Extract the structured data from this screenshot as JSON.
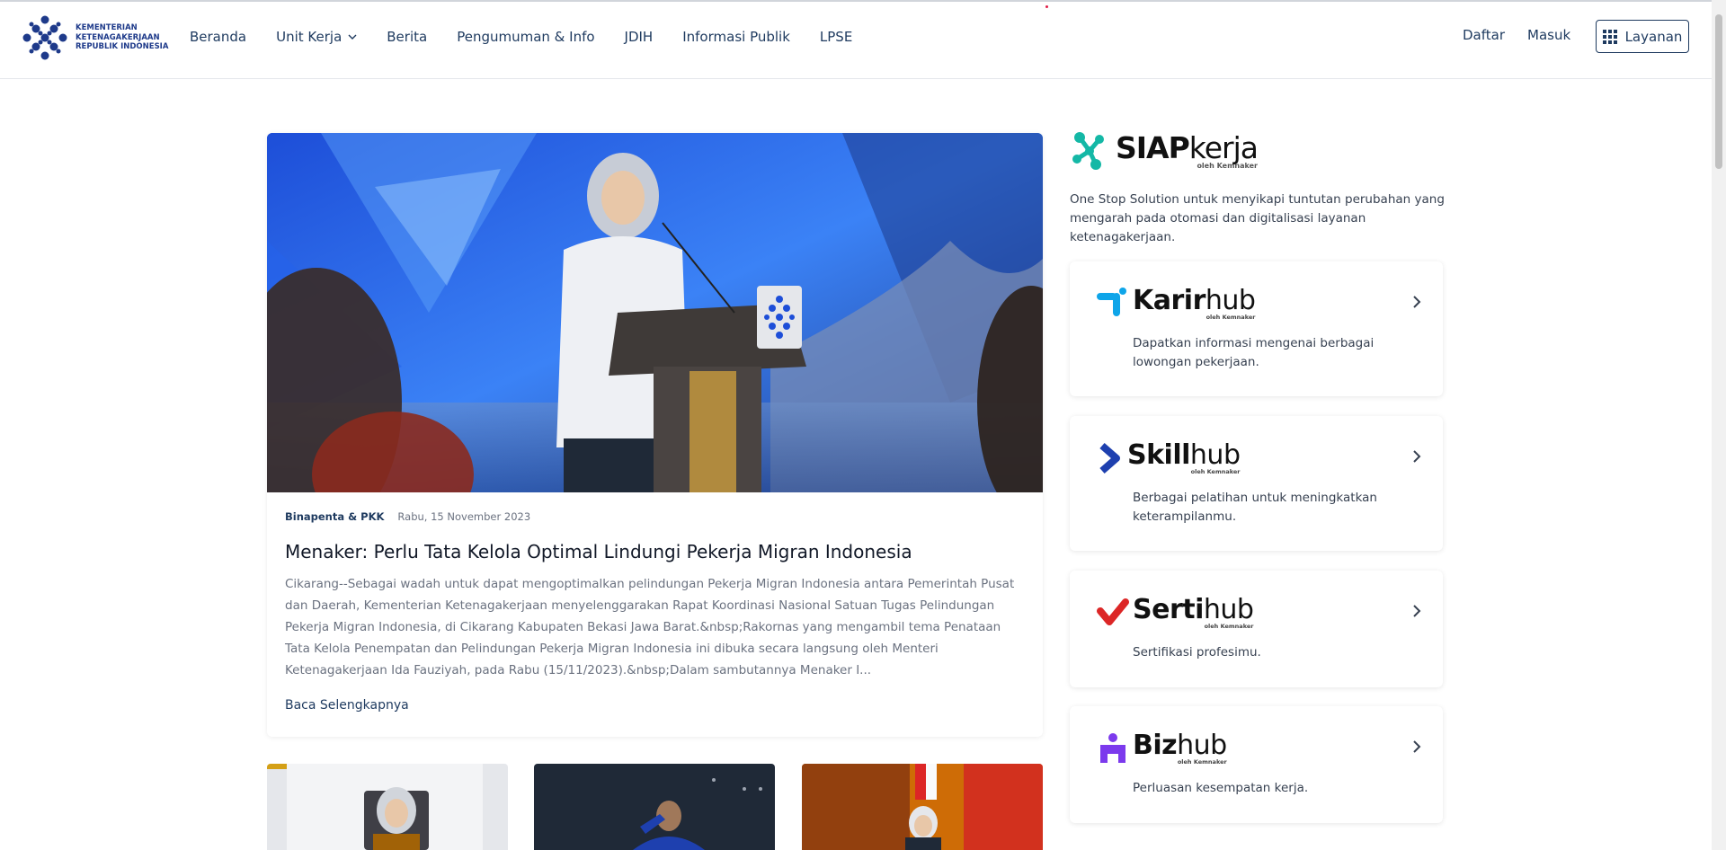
{
  "header": {
    "logo_lines": [
      "KEMENTERIAN",
      "KETENAGAKERJAAN",
      "REPUBLIK INDONESIA"
    ],
    "nav": [
      {
        "label": "Beranda"
      },
      {
        "label": "Unit Kerja",
        "has_dropdown": true
      },
      {
        "label": "Berita"
      },
      {
        "label": "Pengumuman & Info"
      },
      {
        "label": "JDIH"
      },
      {
        "label": "Informasi Publik"
      },
      {
        "label": "LPSE"
      }
    ],
    "daftar": "Daftar",
    "masuk": "Masuk",
    "layanan": "Layanan"
  },
  "featured": {
    "category": "Binapenta & PKK",
    "date": "Rabu, 15 November 2023",
    "title": "Menaker: Perlu Tata Kelola Optimal Lindungi Pekerja Migran Indonesia",
    "excerpt": "Cikarang--Sebagai wadah untuk dapat mengoptimalkan pelindungan Pekerja Migran Indonesia antara Pemerintah Pusat dan Daerah, Kementerian Ketenagakerjaan menyelenggarakan Rapat Koordinasi Nasional Satuan Tugas Pelindungan Pekerja Migran Indonesia, di Cikarang Kabupaten Bekasi Jawa Barat.&nbsp;Rakornas yang mengambil tema Penataan Tata Kelola Penempatan dan Pelindungan Pekerja Migran Indonesia ini dibuka secara langsung oleh Menteri Ketenagakerjaan Ida Fauziyah, pada Rabu (15/11/2023).&nbsp;Dalam sambutannya Menaker I...",
    "read_more": "Baca Selengkapnya"
  },
  "sidebar": {
    "siap_bold": "SIAP",
    "siap_light": "kerja",
    "siap_sub": "oleh Kemnaker",
    "siap_desc": "One Stop Solution untuk menyikapi tuntutan perubahan yang mengarah pada otomasi dan digitalisasi layanan ketenagakerjaan.",
    "services": [
      {
        "bold": "Karir",
        "light": "hub",
        "sub": "oleh Kemnaker",
        "desc": "Dapatkan informasi mengenai berbagai lowongan pekerjaan.",
        "color": "#0ea5e9"
      },
      {
        "bold": "Skill",
        "light": "hub",
        "sub": "oleh Kemnaker",
        "desc": "Berbagai pelatihan untuk meningkatkan keterampilanmu.",
        "color": "#1e40af"
      },
      {
        "bold": "Serti",
        "light": "hub",
        "sub": "oleh Kemnaker",
        "desc": "Sertifikasi profesimu.",
        "color": "#dc2626"
      },
      {
        "bold": "Biz",
        "light": "hub",
        "sub": "oleh Kemnaker",
        "desc": "Perluasan kesempatan kerja.",
        "color": "#7c3aed"
      }
    ]
  },
  "colors": {
    "primary": "#1e3a5f",
    "siap_teal": "#14b8a6"
  }
}
